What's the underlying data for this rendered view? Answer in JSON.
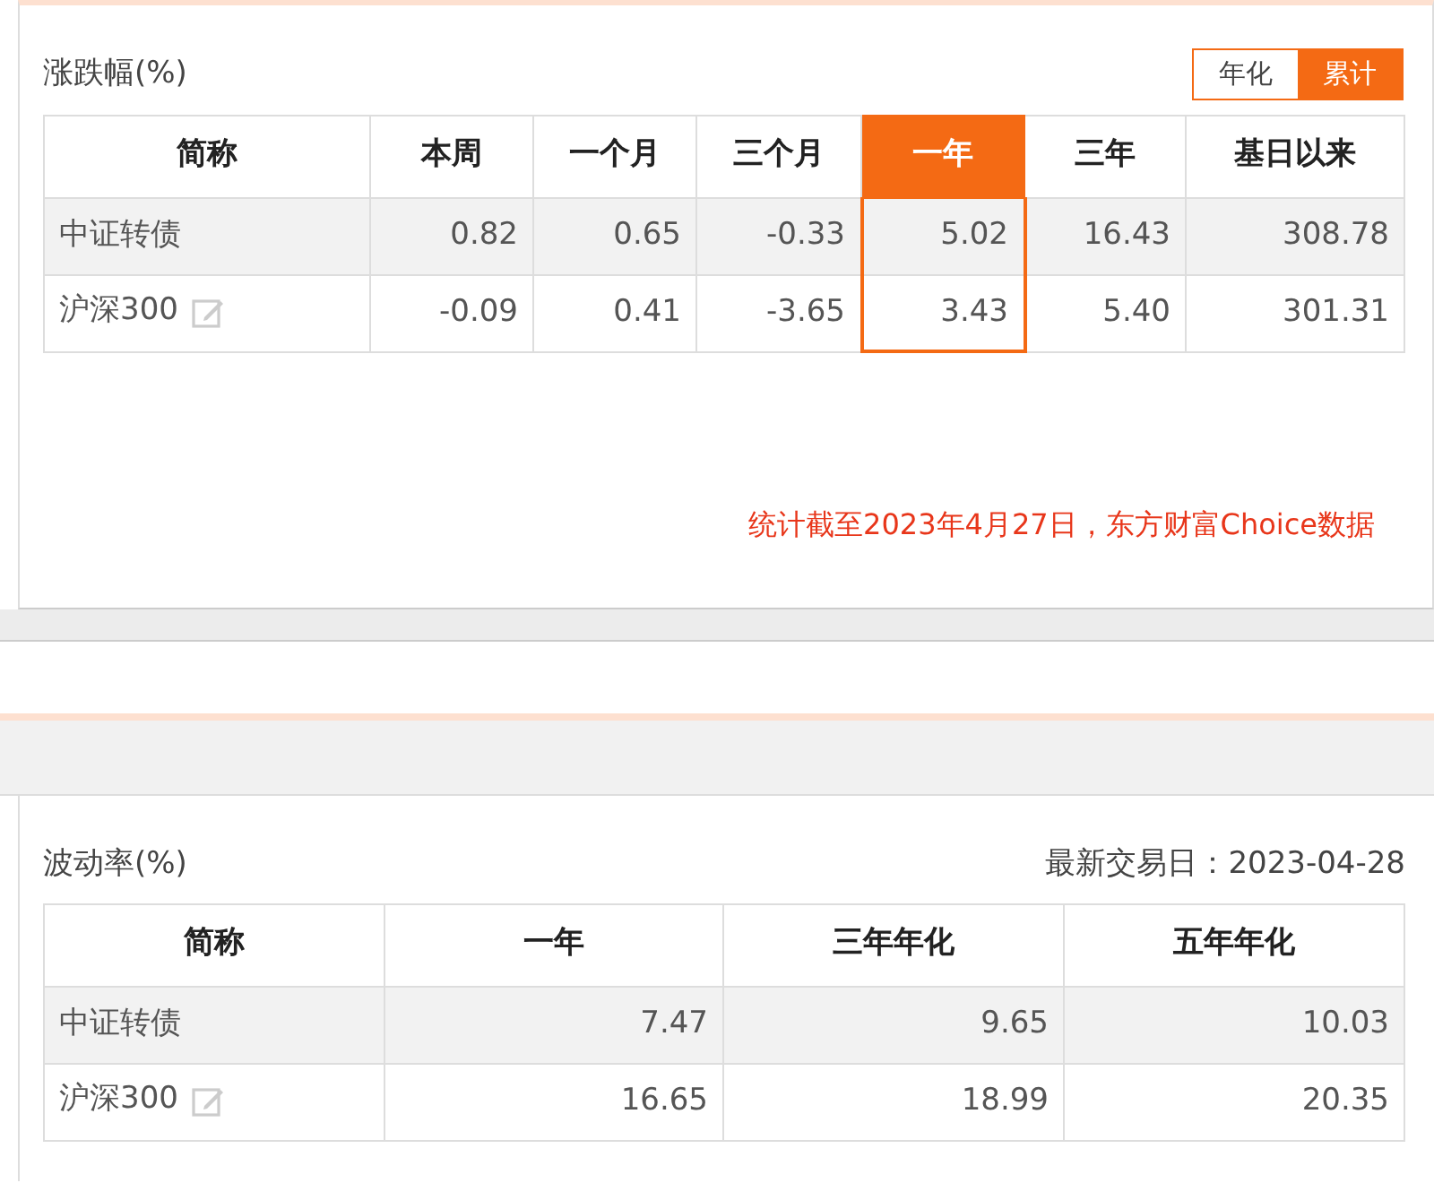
{
  "returns": {
    "title": "涨跌幅(%)",
    "toggle": [
      {
        "label": "年化",
        "selected": false
      },
      {
        "label": "累计",
        "selected": true
      }
    ],
    "columns": [
      {
        "label": "简称",
        "selected": false
      },
      {
        "label": "本周",
        "selected": false
      },
      {
        "label": "一个月",
        "selected": false
      },
      {
        "label": "三个月",
        "selected": false
      },
      {
        "label": "一年",
        "selected": true
      },
      {
        "label": "三年",
        "selected": false
      },
      {
        "label": "基日以来",
        "selected": false
      }
    ],
    "rows": [
      {
        "name": "中证转债",
        "editable": false,
        "values": [
          "0.82",
          "0.65",
          "-0.33",
          "5.02",
          "16.43",
          "308.78"
        ]
      },
      {
        "name": "沪深300",
        "editable": true,
        "values": [
          "-0.09",
          "0.41",
          "-3.65",
          "3.43",
          "5.40",
          "301.31"
        ]
      }
    ],
    "note": "统计截至2023年4月27日，东方财富Choice数据"
  },
  "volatility": {
    "title": "波动率(%)",
    "latest_date": "最新交易日：2023-04-28",
    "columns": [
      {
        "label": "简称",
        "selected": false
      },
      {
        "label": "一年",
        "selected": false
      },
      {
        "label": "三年年化",
        "selected": false
      },
      {
        "label": "五年年化",
        "selected": false
      }
    ],
    "rows": [
      {
        "name": "中证转债",
        "editable": false,
        "values": [
          "7.47",
          "9.65",
          "10.03"
        ]
      },
      {
        "name": "沪深300",
        "editable": true,
        "values": [
          "16.65",
          "18.99",
          "20.35"
        ]
      }
    ]
  }
}
